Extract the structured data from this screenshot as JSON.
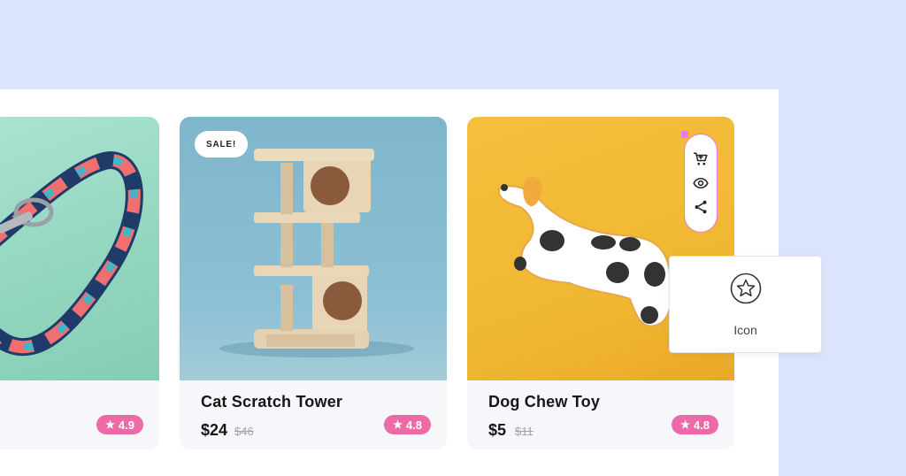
{
  "products": [
    {
      "title": "",
      "price": "",
      "old_price": "",
      "rating": "4.9",
      "image": "colorful-leash"
    },
    {
      "title": "Cat Scratch Tower",
      "price": "$24",
      "old_price": "$46",
      "rating": "4.8",
      "badge": "SALE!",
      "image": "cat-scratch-tower"
    },
    {
      "title": "Dog Chew Toy",
      "price": "$5",
      "old_price": "$11",
      "rating": "4.8",
      "image": "dog-chew-toy"
    }
  ],
  "actions": [
    {
      "name": "add-to-cart",
      "icon": "cart-icon"
    },
    {
      "name": "quick-view",
      "icon": "eye-icon"
    },
    {
      "name": "share",
      "icon": "share-icon"
    }
  ],
  "tooltip": {
    "label": "Icon",
    "icon": "star-icon"
  },
  "colors": {
    "page_bg": "#dce4fd",
    "rating_badge": "#ee6aa7",
    "selection_outline": "#e77ce4",
    "card_leash_bg": "#9fdcc8",
    "card_tower_bg": "#85b9ce",
    "card_toy_bg": "#f1bb35"
  }
}
